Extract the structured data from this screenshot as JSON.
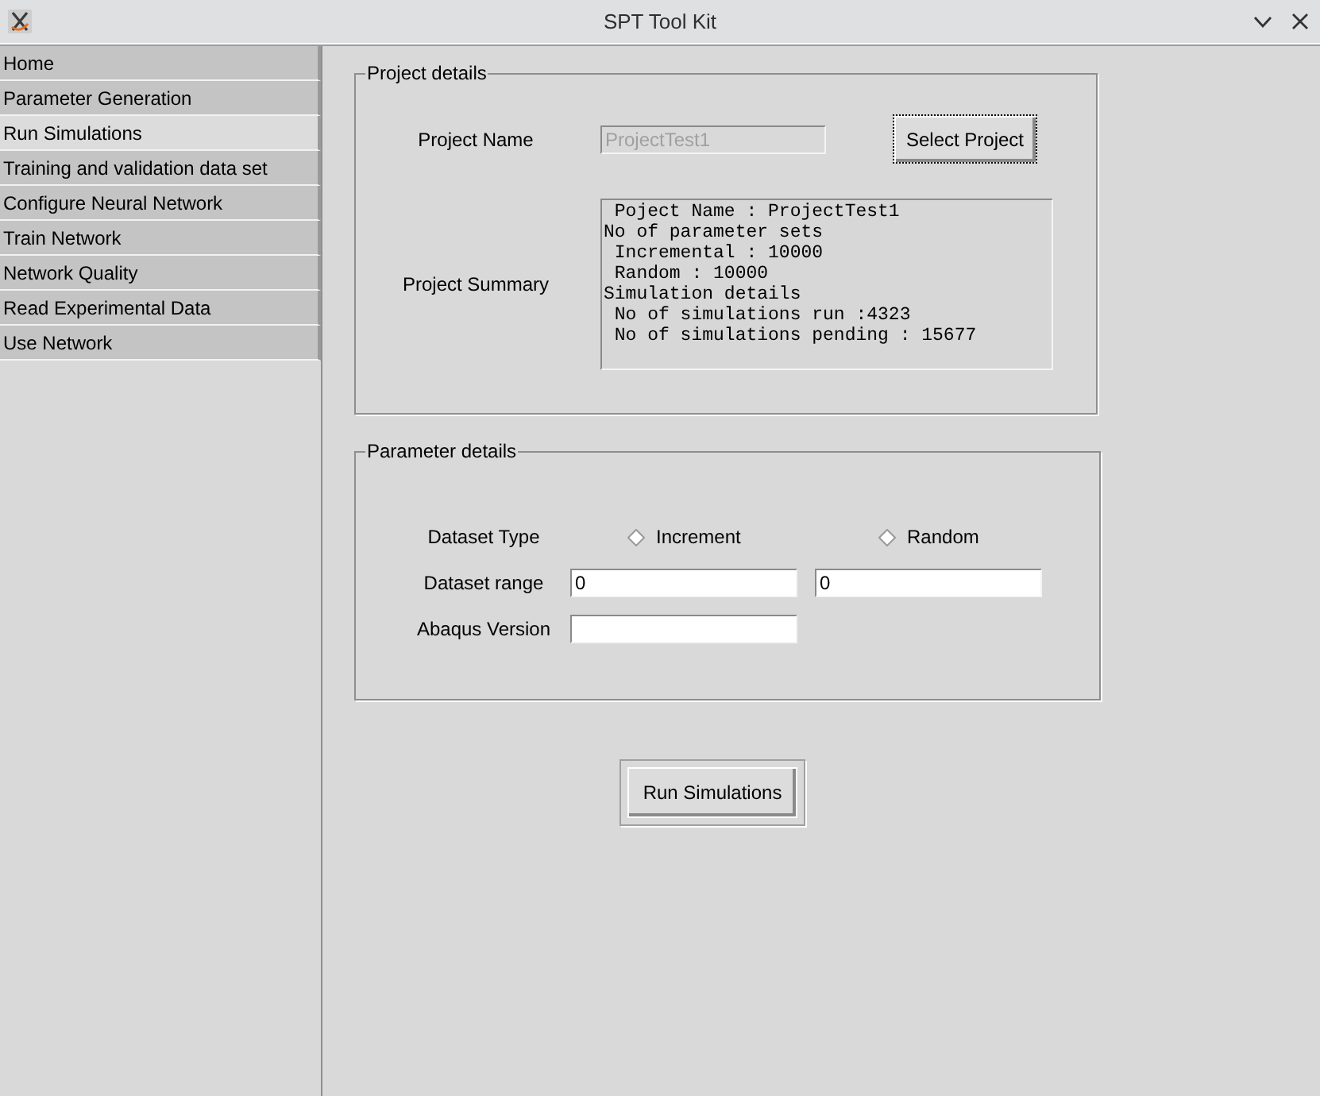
{
  "window": {
    "title": "SPT Tool Kit"
  },
  "sidebar": {
    "items": [
      {
        "label": "Home",
        "selected": false
      },
      {
        "label": "Parameter Generation",
        "selected": false
      },
      {
        "label": "Run Simulations",
        "selected": true
      },
      {
        "label": "Training and validation data set",
        "selected": false
      },
      {
        "label": "Configure Neural Network",
        "selected": false
      },
      {
        "label": "Train Network",
        "selected": false
      },
      {
        "label": "Network Quality",
        "selected": false
      },
      {
        "label": "Read Experimental Data",
        "selected": false
      },
      {
        "label": "Use Network",
        "selected": false
      }
    ]
  },
  "project_details": {
    "title": "Project details",
    "project_name": {
      "label": "Project Name",
      "value": "ProjectTest1",
      "disabled": true
    },
    "select_button": {
      "label": "Select Project",
      "focused": true
    },
    "summary": {
      "label": "Project Summary",
      "lines": [
        " Poject Name : ProjectTest1",
        "No of parameter sets",
        " Incremental : 10000",
        " Random : 10000",
        "Simulation details",
        " No of simulations run :4323",
        " No of simulations pending : 15677"
      ]
    }
  },
  "parameter_details": {
    "title": "Parameter details",
    "dataset_type": {
      "label": "Dataset Type",
      "options": [
        {
          "label": "Increment",
          "selected": false
        },
        {
          "label": "Random",
          "selected": false
        }
      ]
    },
    "dataset_range": {
      "label": "Dataset range",
      "values": [
        "0",
        "0"
      ]
    },
    "abaqus_version": {
      "label": "Abaqus Version"
    }
  },
  "run_button": {
    "label": "Run Simulations",
    "default": true
  }
}
